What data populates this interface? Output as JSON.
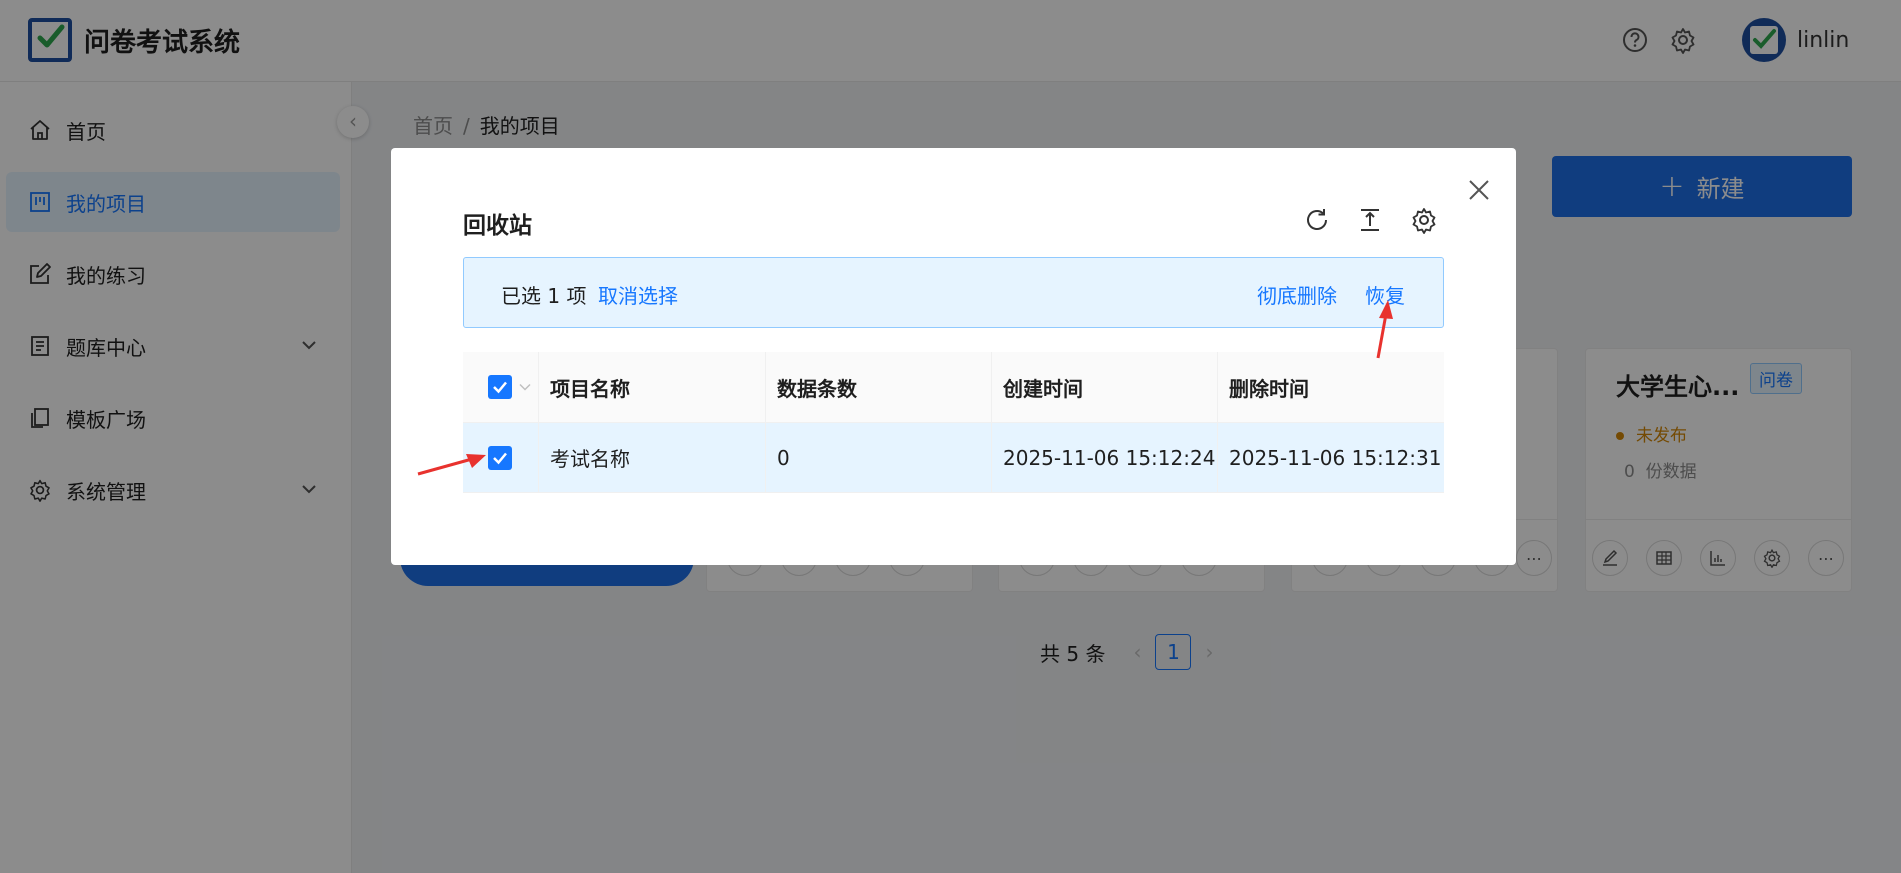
{
  "app": {
    "title": "问卷考试系统",
    "username": "linlin"
  },
  "header": {
    "icons": [
      "question-circle-icon",
      "gear-icon"
    ]
  },
  "sidebar": {
    "items": [
      {
        "label": "首页",
        "icon": "home-icon"
      },
      {
        "label": "我的项目",
        "icon": "project-icon",
        "active": true
      },
      {
        "label": "我的练习",
        "icon": "edit-icon"
      },
      {
        "label": "题库中心",
        "icon": "book-icon",
        "has_submenu": true
      },
      {
        "label": "模板广场",
        "icon": "copy-icon"
      },
      {
        "label": "系统管理",
        "icon": "gear-icon",
        "has_submenu": true
      }
    ]
  },
  "breadcrumb": {
    "home": "首页",
    "separator": "/",
    "current": "我的项目"
  },
  "toolbar": {
    "new_label": "新建"
  },
  "card": {
    "title": "大学生心...",
    "tag": "问卷",
    "status": "未发布",
    "count_value": "0",
    "count_label": "份数据"
  },
  "pagination": {
    "total_text": "共 5 条",
    "current_page": "1"
  },
  "modal": {
    "title": "回收站",
    "tools": [
      "reload-icon",
      "column-height-icon",
      "setting-icon"
    ],
    "alert": {
      "selected_text": "已选 1 项",
      "cancel_select": "取消选择",
      "delete_forever": "彻底删除",
      "restore": "恢复"
    },
    "table": {
      "columns": [
        "项目名称",
        "数据条数",
        "创建时间",
        "删除时间"
      ],
      "rows": [
        {
          "name": "考试名称",
          "count": "0",
          "created": "2025-11-06 15:12:24",
          "deleted": "2025-11-06 15:12:31",
          "checked": true
        }
      ]
    }
  },
  "colors": {
    "primary": "#1677ff",
    "brand": "#1e4fa0",
    "button": "#1e6fe8",
    "warning": "#d48806",
    "annotation": "#e8322e"
  }
}
